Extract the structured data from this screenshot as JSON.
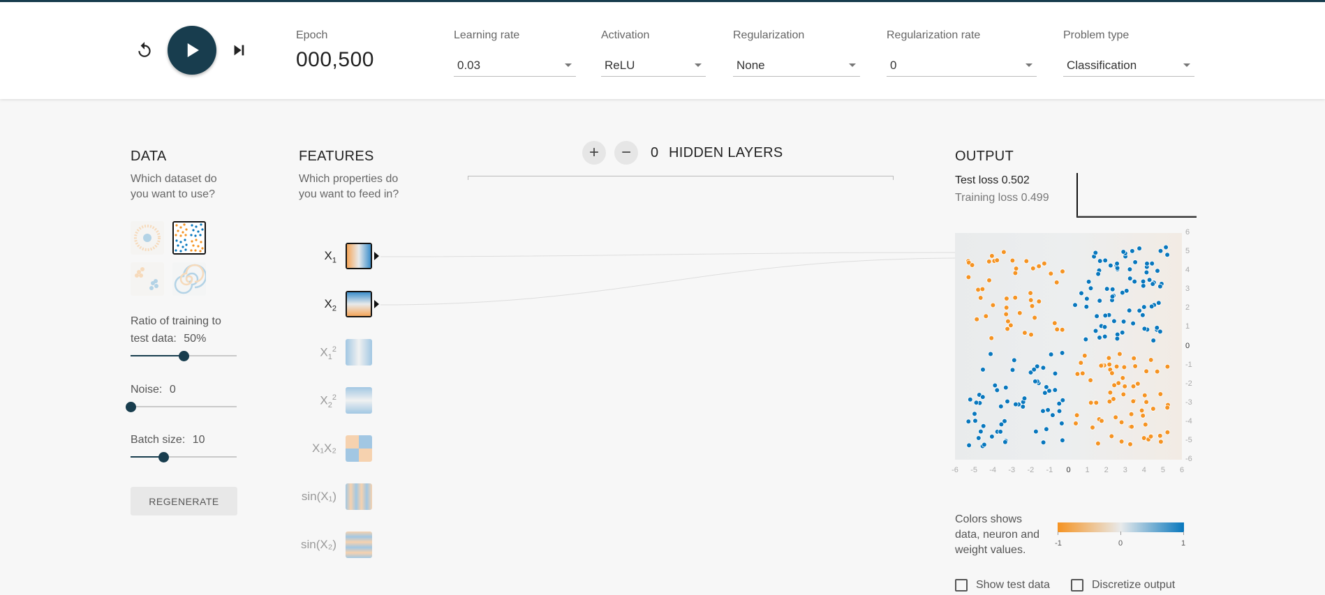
{
  "controls": {
    "epoch_label": "Epoch",
    "epoch_value": "000,500",
    "learning_rate": {
      "label": "Learning rate",
      "value": "0.03"
    },
    "activation": {
      "label": "Activation",
      "value": "ReLU"
    },
    "regularization": {
      "label": "Regularization",
      "value": "None"
    },
    "regularization_rate": {
      "label": "Regularization rate",
      "value": "0"
    },
    "problem_type": {
      "label": "Problem type",
      "value": "Classification"
    }
  },
  "data": {
    "title": "DATA",
    "subtitle_1": "Which dataset do",
    "subtitle_2": "you want to use?",
    "datasets": [
      "circle",
      "xor",
      "gaussian",
      "spiral"
    ],
    "selected_dataset": "xor",
    "ratio_label_1": "Ratio of training to",
    "ratio_label_2": "test data:",
    "ratio_value": "50%",
    "ratio_fraction": 0.5,
    "noise_label": "Noise:",
    "noise_value": "0",
    "noise_fraction": 0,
    "batch_label": "Batch size:",
    "batch_value": "10",
    "batch_fraction": 0.31,
    "regenerate_label": "REGENERATE"
  },
  "features": {
    "title": "FEATURES",
    "subtitle_1": "Which properties do",
    "subtitle_2": "you want to feed in?",
    "items": [
      {
        "base": "X",
        "sub": "1",
        "active": true
      },
      {
        "base": "X",
        "sub": "2",
        "active": true
      },
      {
        "base": "X",
        "sub": "1",
        "sup": "2",
        "active": false
      },
      {
        "base": "X",
        "sub": "2",
        "sup": "2",
        "active": false
      },
      {
        "base": "X₁X₂",
        "active": false
      },
      {
        "base": "sin(X₁)",
        "active": false
      },
      {
        "base": "sin(X₂)",
        "active": false
      }
    ]
  },
  "hidden_layers": {
    "count": "0",
    "label": "HIDDEN LAYERS",
    "add": "+",
    "remove": "−"
  },
  "output": {
    "title": "OUTPUT",
    "test_loss_label": "Test loss",
    "test_loss_value": "0.502",
    "training_loss_label": "Training loss",
    "training_loss_value": "0.499",
    "axis_ticks": [
      "-6",
      "-5",
      "-4",
      "-3",
      "-2",
      "-1",
      "0",
      "1",
      "2",
      "3",
      "4",
      "5",
      "6"
    ],
    "legend_text": "Colors shows data, neuron and weight values.",
    "legend_min": "-1",
    "legend_mid": "0",
    "legend_max": "1",
    "show_test_data": "Show test data",
    "discretize_output": "Discretize output"
  },
  "colors": {
    "accent": "#183d4e",
    "orange": "#f59322",
    "blue": "#0877bd"
  }
}
